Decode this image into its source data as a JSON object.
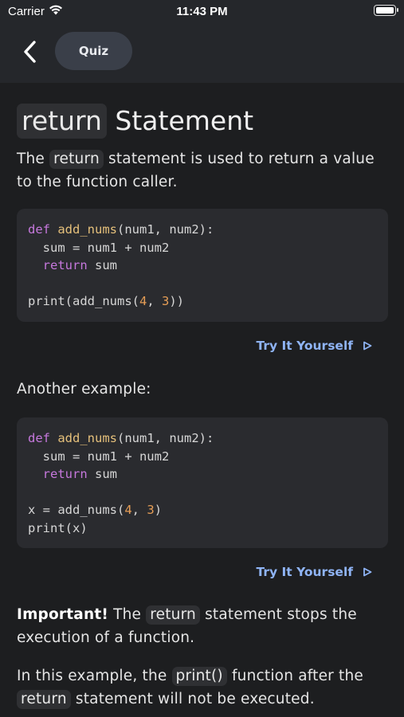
{
  "status_bar": {
    "carrier": "Carrier",
    "time": "11:43 PM"
  },
  "nav": {
    "back_icon": "chevron-left-icon",
    "quiz_label": "Quiz"
  },
  "title": {
    "code": "return",
    "rest": "Statement"
  },
  "intro": {
    "prefix": "The",
    "code": "return",
    "suffix": "statement is used to return a value to the function caller."
  },
  "code_block_1": {
    "line1_def": "def",
    "line1_fn": "add_nums",
    "line1_rest": "(num1, num2):",
    "line2": "  sum = num1 + num2",
    "line3_indent": "  ",
    "line3_kw": "return",
    "line3_rest": " sum",
    "line5_pre": "print(add_nums(",
    "line5_n1": "4",
    "line5_sep": ", ",
    "line5_n2": "3",
    "line5_post": "))"
  },
  "try_it_label": "Try It Yourself",
  "play_icon": "play-triangle-icon",
  "another_example": "Another example:",
  "code_block_2": {
    "line1_def": "def",
    "line1_fn": "add_nums",
    "line1_rest": "(num1, num2):",
    "line2": "  sum = num1 + num2",
    "line3_indent": "  ",
    "line3_kw": "return",
    "line3_rest": " sum",
    "line5_pre": "x = add_nums(",
    "line5_n1": "4",
    "line5_sep": ", ",
    "line5_n2": "3",
    "line5_post": ")",
    "line6": "print(x)"
  },
  "important": {
    "bold": "Important!",
    "prefix": "The",
    "code": "return",
    "suffix": "statement stops the execution of a function."
  },
  "example_note": {
    "prefix": "In this example, the",
    "code1": "print()",
    "middle": "function after the",
    "code2": "return",
    "suffix": "statement will not be executed."
  }
}
